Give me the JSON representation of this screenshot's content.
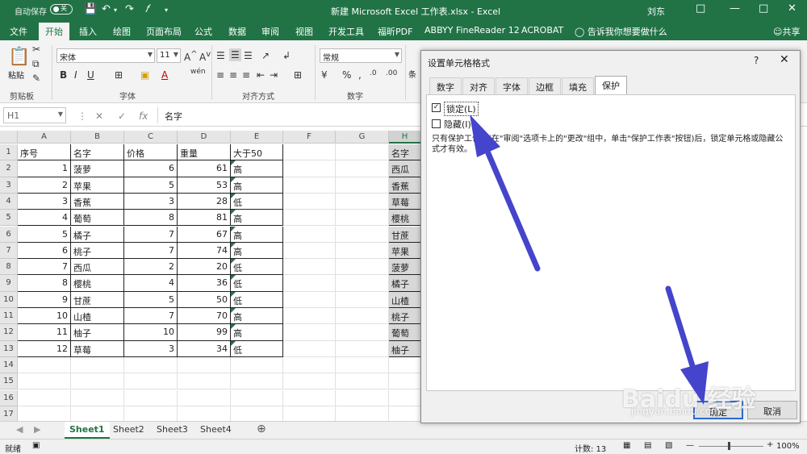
{
  "titlebar": {
    "autosave": "自动保存",
    "autosave_state": "关",
    "title": "新建 Microsoft Excel 工作表.xlsx  -  Excel",
    "user": "刘东"
  },
  "tabs": [
    "文件",
    "开始",
    "插入",
    "绘图",
    "页面布局",
    "公式",
    "数据",
    "审阅",
    "视图",
    "开发工具",
    "福昕PDF",
    "ABBYY FineReader 12",
    "ACROBAT"
  ],
  "active_tab": "开始",
  "tell_me": "告诉我你想要做什么",
  "share": "共享",
  "ribbon": {
    "paste": "粘贴",
    "clipboard": "剪贴板",
    "font_name": "宋体",
    "font_size": "11",
    "font_group": "字体",
    "align_group": "对齐方式",
    "number_format": "常规",
    "number_group": "数字",
    "style_partial": "条"
  },
  "formula_bar": {
    "name_box": "H1",
    "fx": "fx",
    "formula": "名字"
  },
  "grid": {
    "columns": [
      "A",
      "B",
      "C",
      "D",
      "E",
      "F",
      "G",
      "H"
    ],
    "rows": [
      "1",
      "2",
      "3",
      "4",
      "5",
      "6",
      "7",
      "8",
      "9",
      "10",
      "11",
      "12",
      "13",
      "14",
      "15",
      "16",
      "17"
    ],
    "headers": [
      "序号",
      "名字",
      "价格",
      "重量",
      "大于50"
    ],
    "table": [
      [
        "1",
        "菠萝",
        "6",
        "61",
        "高"
      ],
      [
        "2",
        "苹果",
        "5",
        "53",
        "高"
      ],
      [
        "3",
        "香蕉",
        "3",
        "28",
        "低"
      ],
      [
        "4",
        "葡萄",
        "8",
        "81",
        "高"
      ],
      [
        "5",
        "橘子",
        "7",
        "67",
        "高"
      ],
      [
        "6",
        "桃子",
        "7",
        "74",
        "高"
      ],
      [
        "7",
        "西瓜",
        "2",
        "20",
        "低"
      ],
      [
        "8",
        "樱桃",
        "4",
        "36",
        "低"
      ],
      [
        "9",
        "甘蔗",
        "5",
        "50",
        "低"
      ],
      [
        "10",
        "山楂",
        "7",
        "70",
        "高"
      ],
      [
        "11",
        "柚子",
        "10",
        "99",
        "高"
      ],
      [
        "12",
        "草莓",
        "3",
        "34",
        "低"
      ]
    ],
    "h_column": [
      "名字",
      "西瓜",
      "香蕉",
      "草莓",
      "樱桃",
      "甘蔗",
      "苹果",
      "菠萝",
      "橘子",
      "山楂",
      "桃子",
      "葡萄",
      "柚子"
    ]
  },
  "sheets": [
    "Sheet1",
    "Sheet2",
    "Sheet3",
    "Sheet4"
  ],
  "active_sheet": "Sheet1",
  "status": {
    "ready": "就绪",
    "count": "计数: 13",
    "zoom": "100%"
  },
  "dialog": {
    "title": "设置单元格格式",
    "help": "?",
    "close": "✕",
    "tabs": [
      "数字",
      "对齐",
      "字体",
      "边框",
      "填充",
      "保护"
    ],
    "active_tab": "保护",
    "locked_label": "锁定(L)",
    "locked_checked": true,
    "hidden_label": "隐藏(I)",
    "hidden_checked": false,
    "note": "只有保护工作表(在\"审阅\"选项卡上的\"更改\"组中，单击\"保护工作表\"按钮)后，锁定单元格或隐藏公式才有效。",
    "ok": "确定",
    "cancel": "取消"
  },
  "annotation_color": "#4444cc",
  "watermark": {
    "brand": "Baidu 经验",
    "url": "jingyan.baidu.com"
  }
}
